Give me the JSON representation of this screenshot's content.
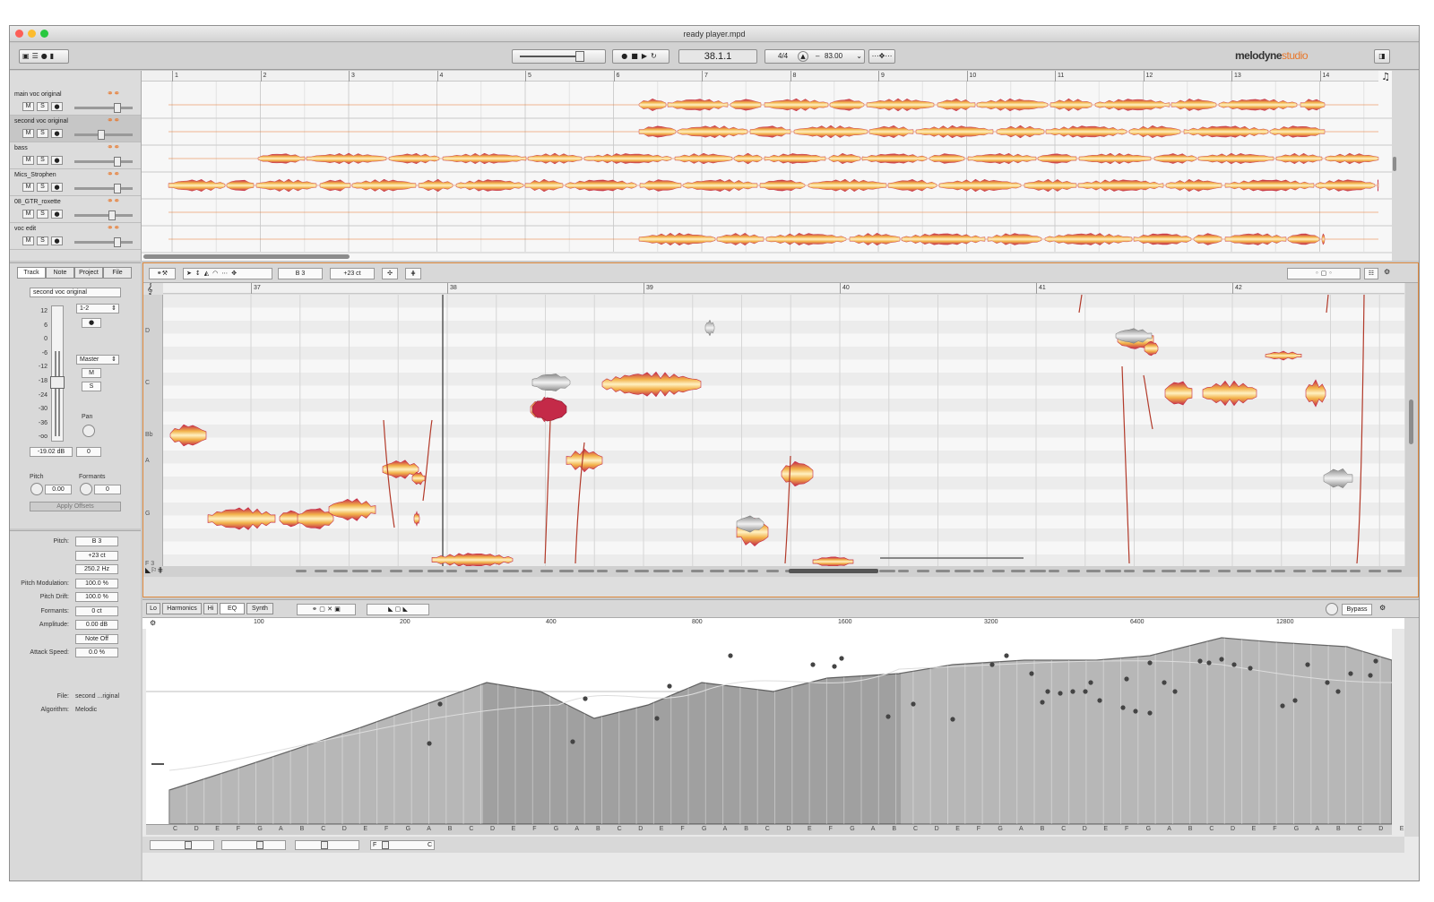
{
  "window": {
    "title": "ready player.mpd",
    "brand": "melodyne",
    "brand_suffix": "studio"
  },
  "transport": {
    "position": "38.1.1",
    "meter": "4/4",
    "tempo": "83.00",
    "icons": [
      "record-icon",
      "stop-icon",
      "play-icon",
      "loop-icon"
    ]
  },
  "arrange": {
    "bars": [
      "1",
      "2",
      "3",
      "4",
      "5",
      "6",
      "7",
      "8",
      "9",
      "10",
      "11",
      "12",
      "13",
      "14"
    ],
    "tracks": [
      {
        "name": "main voc original",
        "m": "M",
        "s": "S"
      },
      {
        "name": "second voc original",
        "m": "M",
        "s": "S"
      },
      {
        "name": "bass",
        "m": "M",
        "s": "S"
      },
      {
        "name": "Mics_Strophen",
        "m": "M",
        "s": "S"
      },
      {
        "name": "08_GTR_roxette",
        "m": "M",
        "s": "S"
      },
      {
        "name": "voc edit",
        "m": "M",
        "s": "S"
      }
    ]
  },
  "inspector": {
    "tabs": [
      "Track",
      "Note",
      "Project",
      "File"
    ],
    "track_name": "second voc original",
    "db_scale": [
      "12",
      "6",
      "0",
      "-6",
      "-12",
      "-18",
      "-24",
      "-30",
      "-36",
      "-oo"
    ],
    "channel": "1-2",
    "output": "Master",
    "mute": "M",
    "solo": "S",
    "pan_label": "Pan",
    "level": "-19.02 dB",
    "pan_value": "0",
    "pitch_label": "Pitch",
    "pitch_value": "0.00",
    "formants_label": "Formants",
    "formants_value": "0",
    "apply_offsets": "Apply Offsets"
  },
  "note_info": {
    "rows": [
      {
        "label": "Pitch:",
        "value": "B 3"
      },
      {
        "label": "",
        "value": "+23 ct"
      },
      {
        "label": "",
        "value": "250.2 Hz"
      },
      {
        "label": "Pitch Modulation:",
        "value": "100.0 %"
      },
      {
        "label": "Pitch Drift:",
        "value": "100.0 %"
      },
      {
        "label": "Formants:",
        "value": "0 ct"
      },
      {
        "label": "Amplitude:",
        "value": "0.00 dB"
      },
      {
        "label": "",
        "value": "Note Off"
      },
      {
        "label": "Attack Speed:",
        "value": "0.0 %"
      }
    ],
    "file_label": "File:",
    "file_value": "second ...riginal",
    "algorithm_label": "Algorithm:",
    "algorithm_value": "Melodic"
  },
  "editor": {
    "pitch": "B 3",
    "cents": "+23 ct",
    "bars": [
      "37",
      "38",
      "39",
      "40",
      "41",
      "42"
    ],
    "keys": [
      "D",
      "C",
      "Bb",
      "A",
      "G",
      "F 3"
    ]
  },
  "sound_editor": {
    "tabs": [
      "Lo",
      "Harmonics",
      "Hi",
      "EQ",
      "Synth"
    ],
    "active_tab": "EQ",
    "bypass": "Bypass",
    "freqs": [
      "100",
      "200",
      "400",
      "800",
      "1600",
      "3200",
      "6400",
      "12800"
    ],
    "bottom_left": "F",
    "bottom_right": "C",
    "notes": [
      "C",
      "D",
      "E",
      "F",
      "G",
      "A",
      "B",
      "C",
      "D",
      "E",
      "F",
      "G",
      "A",
      "B",
      "C",
      "D",
      "E",
      "F",
      "G",
      "A",
      "B",
      "C",
      "D",
      "E",
      "F",
      "G",
      "A",
      "B",
      "C",
      "D",
      "E",
      "F",
      "G",
      "A",
      "B",
      "C",
      "D",
      "E",
      "F",
      "G",
      "A",
      "B",
      "C",
      "D",
      "E",
      "F",
      "G",
      "A",
      "B",
      "C",
      "D",
      "E",
      "F",
      "G",
      "A",
      "B",
      "C",
      "D",
      "E"
    ]
  },
  "colors": {
    "accent": "#e8772b",
    "blob_hot": "#c42a48",
    "blob_warm": "#f2b24a",
    "blob_light": "#fff1c2"
  }
}
